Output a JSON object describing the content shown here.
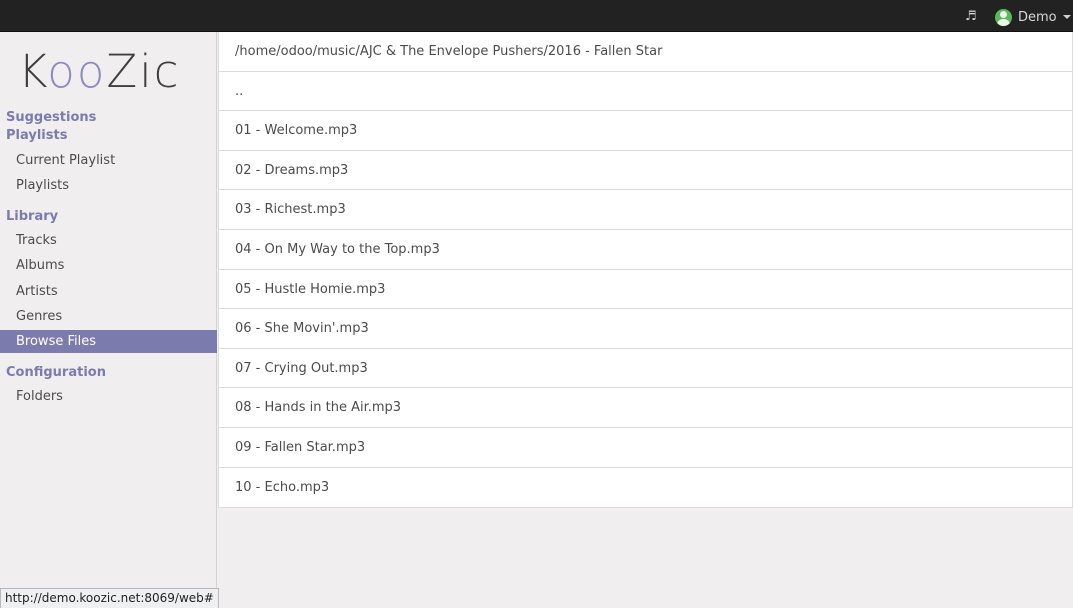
{
  "topbar": {
    "music_icon": "music-note-icon",
    "user_name": "Demo"
  },
  "logo": {
    "text_k": "K",
    "text_o1": "o",
    "text_o2": "o",
    "text_zic": "Zic"
  },
  "sidebar": {
    "suggestions": "Suggestions",
    "playlists_header": "Playlists",
    "current_playlist": "Current Playlist",
    "playlists": "Playlists",
    "library_header": "Library",
    "tracks": "Tracks",
    "albums": "Albums",
    "artists": "Artists",
    "genres": "Genres",
    "browse_files": "Browse Files",
    "configuration_header": "Configuration",
    "folders": "Folders"
  },
  "browser": {
    "path": "/home/odoo/music/AJC & The Envelope Pushers/2016 - Fallen Star",
    "parent": "..",
    "files": [
      "01 - Welcome.mp3",
      "02 - Dreams.mp3",
      "03 - Richest.mp3",
      "04 - On My Way to the Top.mp3",
      "05 - Hustle Homie.mp3",
      "06 - She Movin'.mp3",
      "07 - Crying Out.mp3",
      "08 - Hands in the Air.mp3",
      "09 - Fallen Star.mp3",
      "10 - Echo.mp3"
    ]
  },
  "status_url": "http://demo.koozic.net:8069/web#"
}
